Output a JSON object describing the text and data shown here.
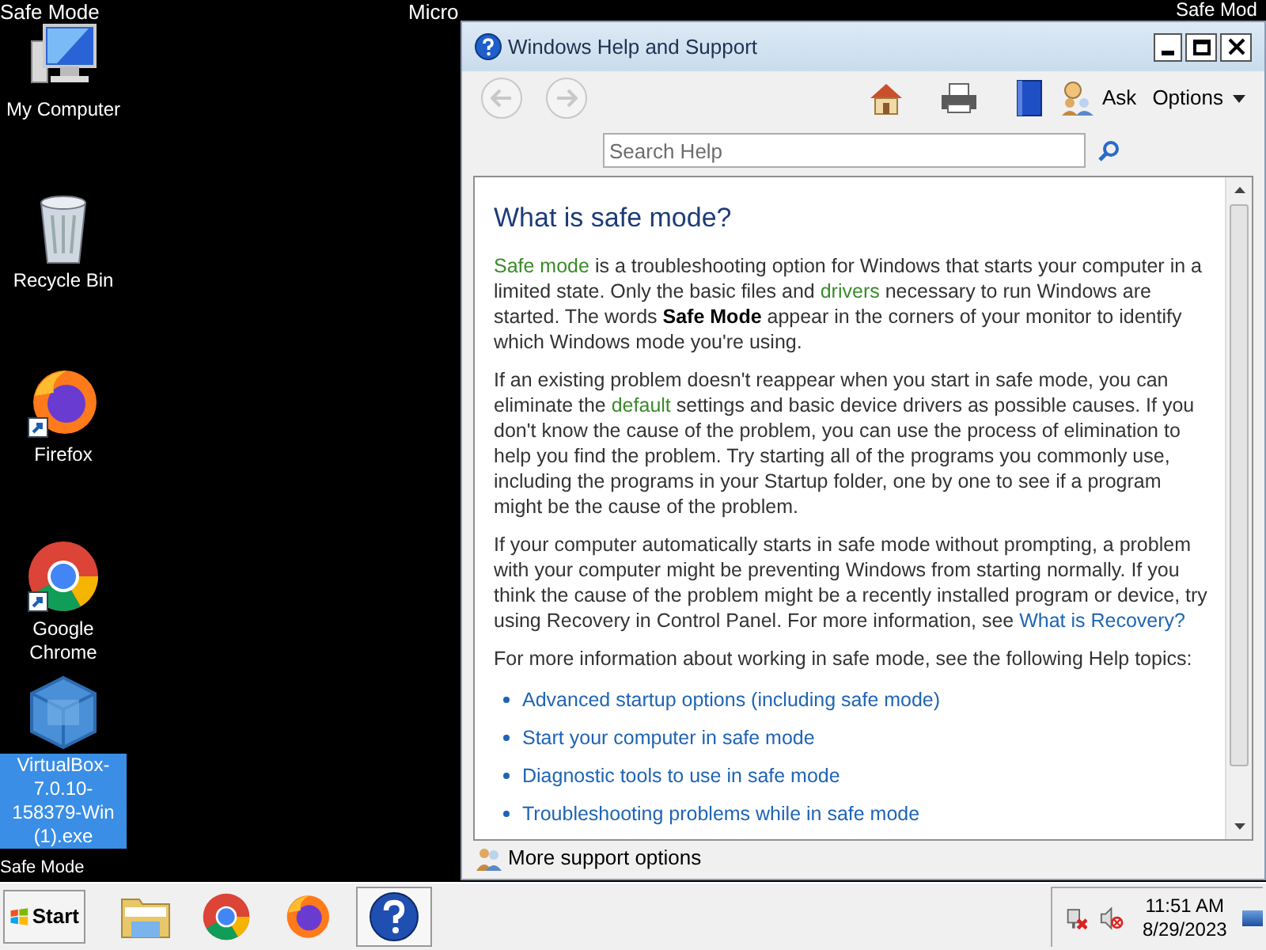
{
  "desktop": {
    "top_left_label": "Safe Mode",
    "top_center_label": "Micro",
    "top_right_label": "Safe Mod",
    "bottom_left_label": "Safe Mode",
    "icons": [
      {
        "label": "My Computer",
        "kind": "computer",
        "selected": false
      },
      {
        "label": "Recycle Bin",
        "kind": "recycle",
        "selected": false
      },
      {
        "label": "Firefox",
        "kind": "firefox",
        "selected": false
      },
      {
        "label": "Google Chrome",
        "kind": "chrome",
        "selected": false
      },
      {
        "label": "VirtualBox-7.0.10-158379-Win (1).exe",
        "kind": "virtualbox",
        "selected": true
      }
    ]
  },
  "help_window": {
    "title": "Windows Help and Support",
    "toolbar": {
      "back_disabled": true,
      "forward_disabled": true,
      "ask_label": "Ask",
      "options_label": "Options"
    },
    "search": {
      "placeholder": "Search Help"
    },
    "article": {
      "heading": "What is safe mode?",
      "paragraphs": [
        [
          {
            "kind": "term",
            "text": "Safe mode"
          },
          {
            "kind": "plain",
            "text": " is a troubleshooting option for Windows that starts your computer in a limited state. Only the basic files and "
          },
          {
            "kind": "term",
            "text": "drivers"
          },
          {
            "kind": "plain",
            "text": " necessary to run Windows are started. The words "
          },
          {
            "kind": "bold",
            "text": "Safe Mode"
          },
          {
            "kind": "plain",
            "text": " appear in the corners of your monitor to identify which Windows mode you're using."
          }
        ],
        [
          {
            "kind": "plain",
            "text": "If an existing problem doesn't reappear when you start in safe mode, you can eliminate the "
          },
          {
            "kind": "term",
            "text": "default"
          },
          {
            "kind": "plain",
            "text": " settings and basic device drivers as possible causes. If you don't know the cause of the problem, you can use the process of elimination to help you find the problem. Try starting all of the programs you commonly use, including the programs in your Startup folder, one by one to see if a program might be the cause of the problem."
          }
        ],
        [
          {
            "kind": "plain",
            "text": "If your computer automatically starts in safe mode without prompting, a problem with your computer might be preventing Windows from starting normally. If you think the cause of the problem might be a recently installed program or device, try using Recovery in Control Panel. For more information, see "
          },
          {
            "kind": "link",
            "text": "What is Recovery?"
          }
        ],
        [
          {
            "kind": "plain",
            "text": "For more information about working in safe mode, see the following Help topics:"
          }
        ]
      ],
      "links": [
        "Advanced startup options (including safe mode)",
        "Start your computer in safe mode",
        "Diagnostic tools to use in safe mode",
        "Troubleshooting problems while in safe mode"
      ]
    },
    "footer": {
      "label": "More support options"
    }
  },
  "taskbar": {
    "start_label": "Start",
    "pinned": [
      {
        "kind": "explorer"
      },
      {
        "kind": "chrome"
      },
      {
        "kind": "firefox"
      },
      {
        "kind": "help",
        "selected": true
      }
    ],
    "tray": {
      "network_disconnected": true,
      "sound_muted": true,
      "time": "11:51 AM",
      "date": "8/29/2023"
    }
  }
}
